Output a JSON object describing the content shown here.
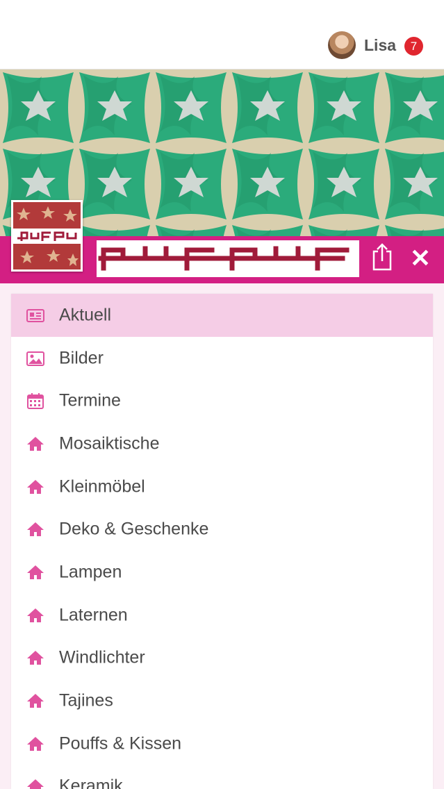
{
  "header": {
    "username": "Lisa",
    "notification_count": "7"
  },
  "colors": {
    "brand_magenta": "#d31f83",
    "active_row": "#f5cde6",
    "icon_pink": "#e0529f",
    "badge_red": "#e0262f"
  },
  "actions": {
    "share_icon": "share-icon",
    "close_icon": "close-icon",
    "close_glyph": "✕"
  },
  "menu": {
    "items": [
      {
        "label": "Aktuell",
        "icon": "news-icon",
        "active": true
      },
      {
        "label": "Bilder",
        "icon": "image-icon"
      },
      {
        "label": "Termine",
        "icon": "calendar-icon"
      },
      {
        "label": "Mosaiktische",
        "icon": "home-icon"
      },
      {
        "label": "Kleinmöbel",
        "icon": "home-icon"
      },
      {
        "label": "Deko & Geschenke",
        "icon": "home-icon"
      },
      {
        "label": "Lampen",
        "icon": "home-icon"
      },
      {
        "label": "Laternen",
        "icon": "home-icon"
      },
      {
        "label": "Windlichter",
        "icon": "home-icon"
      },
      {
        "label": "Tajines",
        "icon": "home-icon"
      },
      {
        "label": "Pouffs & Kissen",
        "icon": "home-icon"
      },
      {
        "label": "Keramik",
        "icon": "home-icon"
      }
    ]
  }
}
